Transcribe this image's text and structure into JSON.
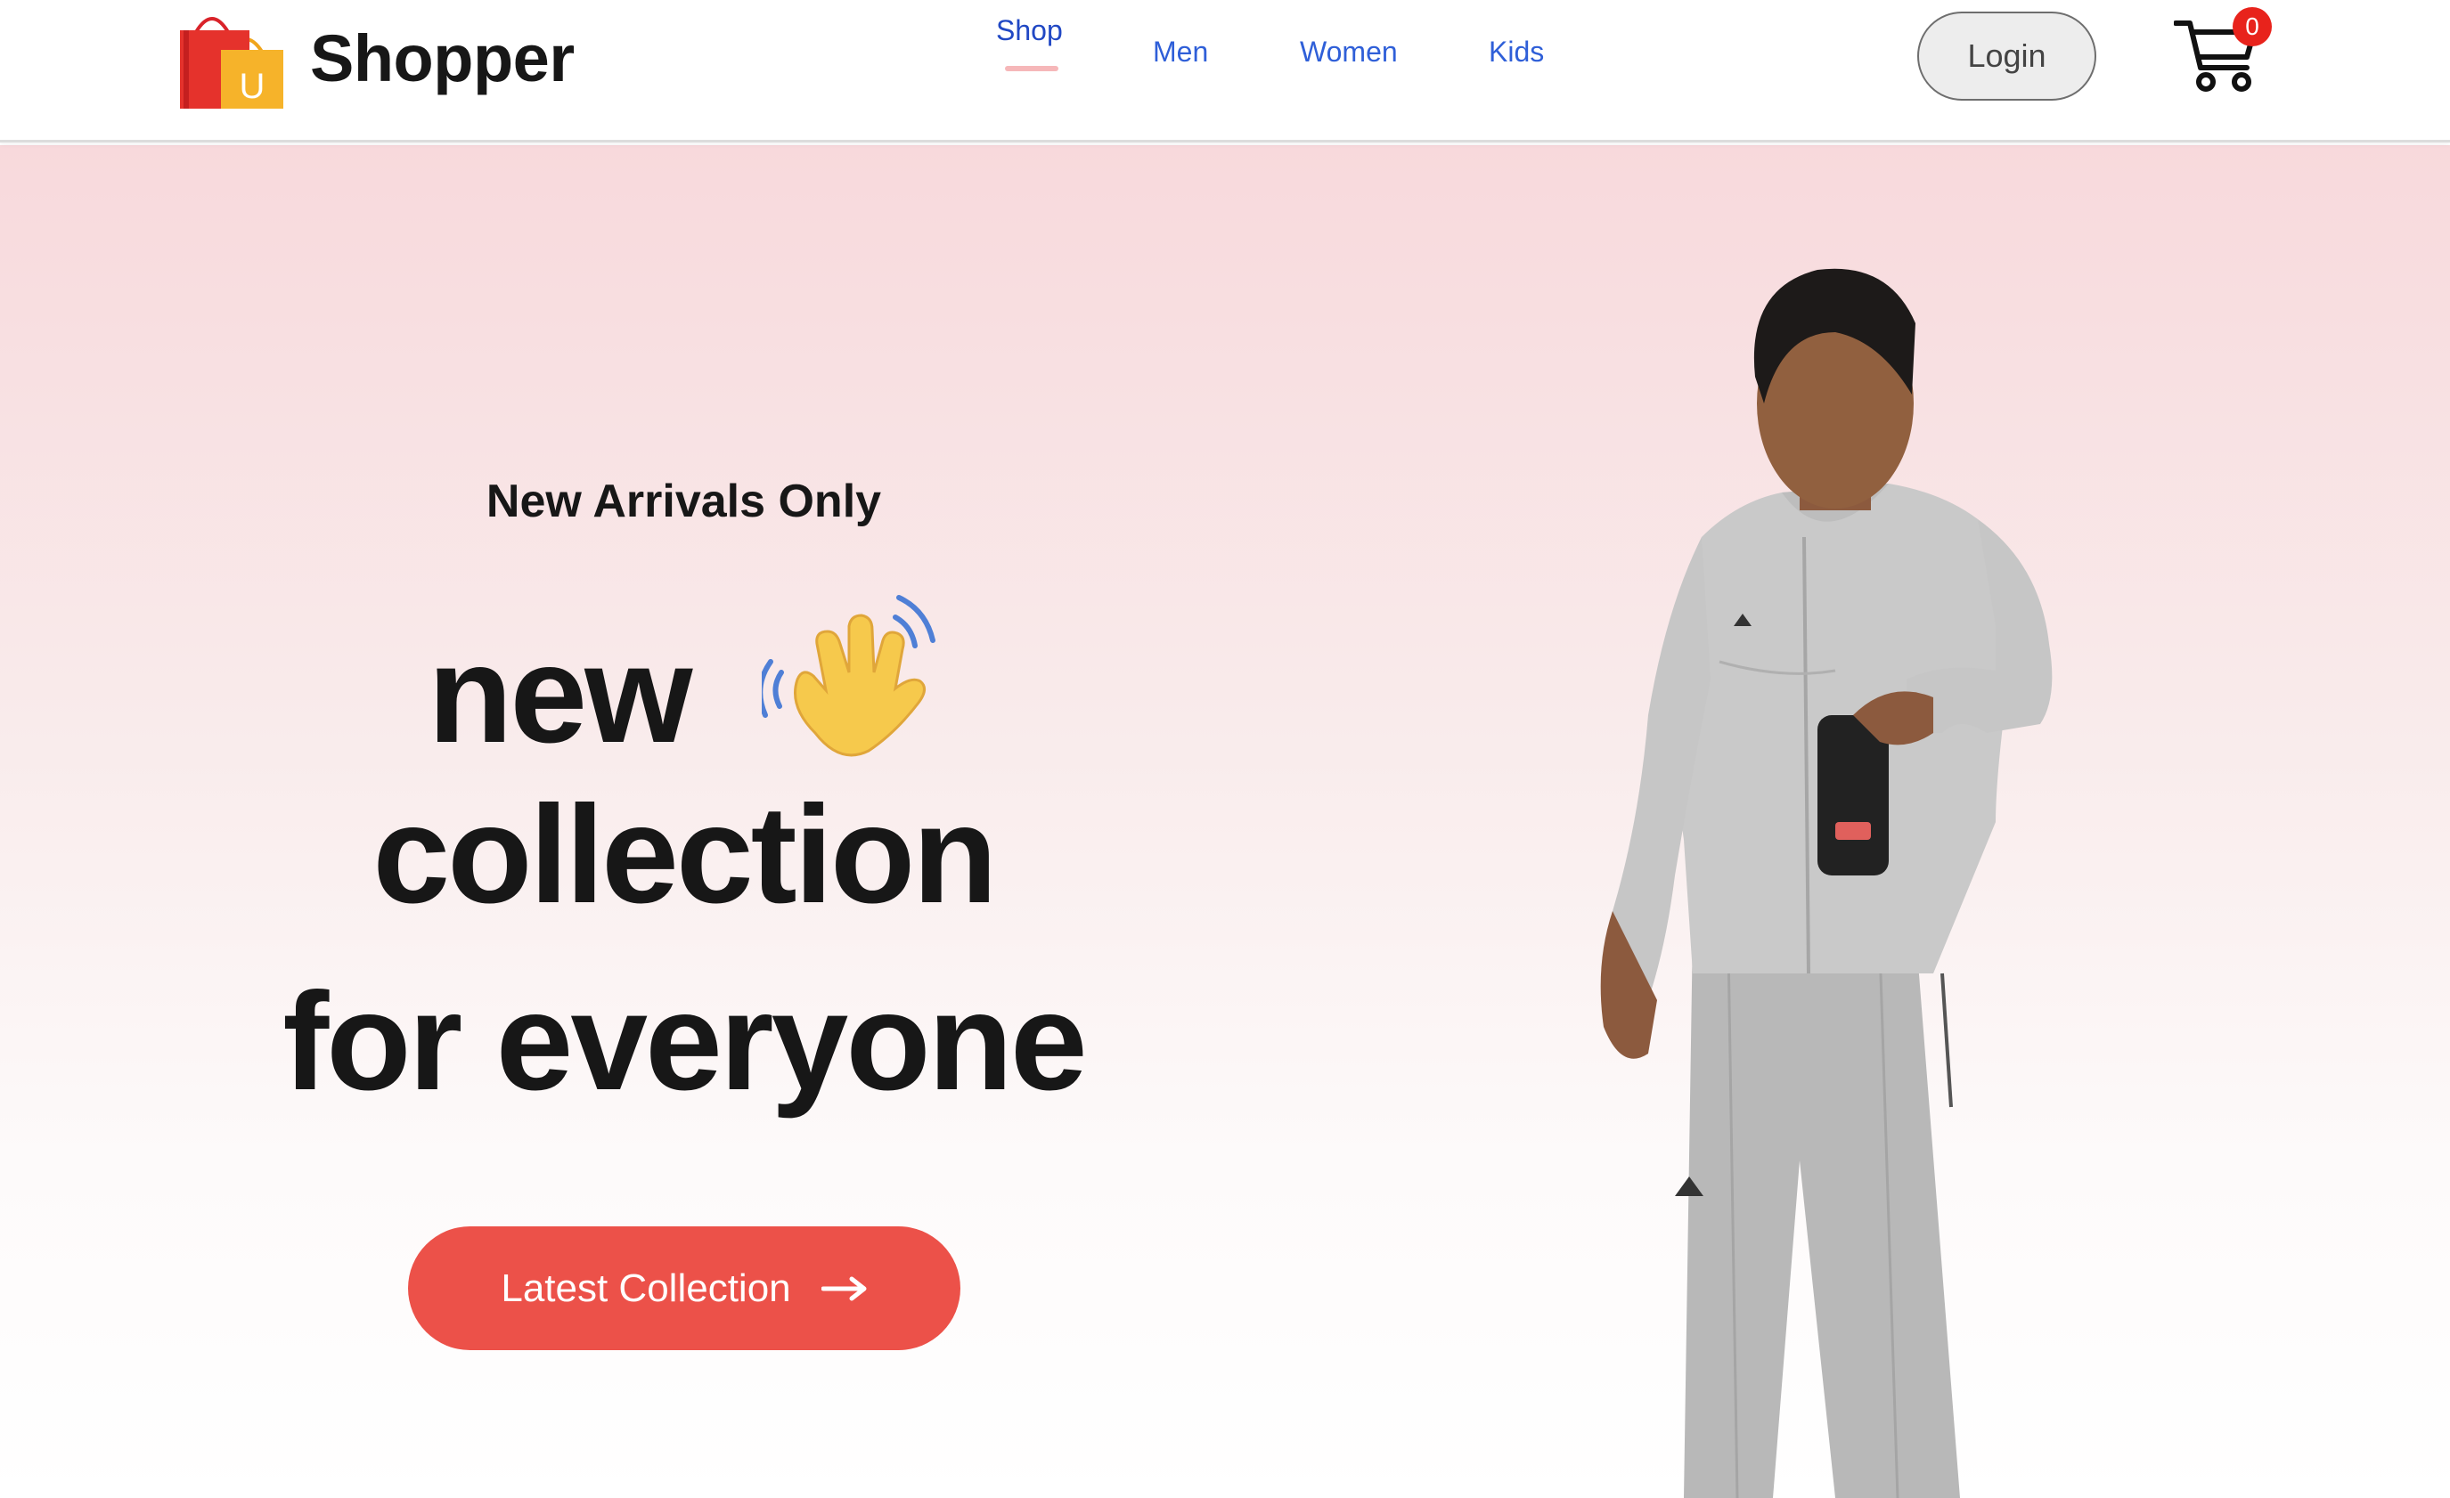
{
  "header": {
    "brand": "Shopper",
    "nav": [
      {
        "label": "Shop",
        "active": true
      },
      {
        "label": "Men",
        "active": false
      },
      {
        "label": "Women",
        "active": false
      },
      {
        "label": "Kids",
        "active": false
      }
    ],
    "login_label": "Login",
    "cart_count": "0"
  },
  "hero": {
    "subtitle": "New Arrivals Only",
    "line1": "new",
    "line2": "collection",
    "line3": "for everyone",
    "cta_label": "Latest Collection",
    "hand_icon": "waving-hand-icon",
    "arrow_icon": "arrow-right-icon"
  },
  "colors": {
    "accent": "#ec5149",
    "nav_link": "#2f5fd8",
    "hero_gradient_top": "#f8d9dc",
    "cart_badge": "#e8231c"
  }
}
